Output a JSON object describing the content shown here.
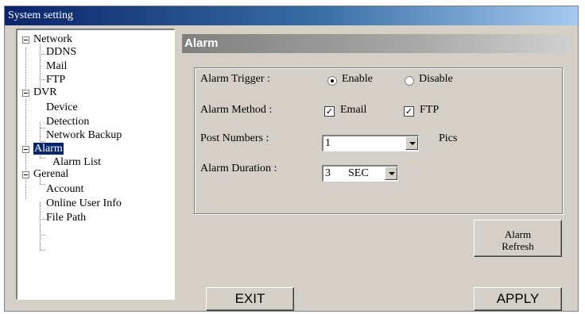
{
  "window": {
    "title": "System setting"
  },
  "tree": {
    "network": {
      "label": "Network",
      "children": [
        "DDNS",
        "Mail",
        "FTP"
      ]
    },
    "dvr": {
      "label": "DVR",
      "children": [
        "Device",
        "Detection",
        "Network Backup"
      ]
    },
    "alarm": {
      "label": "Alarm",
      "children": [
        "Alarm List"
      ],
      "selected": true
    },
    "general": {
      "label": "Gerenal",
      "children": [
        "Account",
        "Online User Info",
        "File Path"
      ]
    }
  },
  "panel": {
    "header": "Alarm",
    "trigger": {
      "label": "Alarm Trigger :",
      "enable": "Enable",
      "disable": "Disable",
      "selected": "Enable"
    },
    "method": {
      "label": "Alarm Method :",
      "email": "Email",
      "email_checked": true,
      "ftp": "FTP",
      "ftp_checked": true,
      "check_glyph": "✓"
    },
    "post": {
      "label": "Post Numbers :",
      "value": "1",
      "unit": "Pics"
    },
    "duration": {
      "label": "Alarm Duration :",
      "value": "3",
      "unit": "SEC"
    }
  },
  "buttons": {
    "refresh_line1": "Alarm",
    "refresh_line2": "Refresh",
    "exit": "EXIT",
    "apply": "APPLY"
  },
  "colors": {
    "titlebar": "#0a246a",
    "selection": "#0a246a",
    "face": "#d4d0c8"
  }
}
